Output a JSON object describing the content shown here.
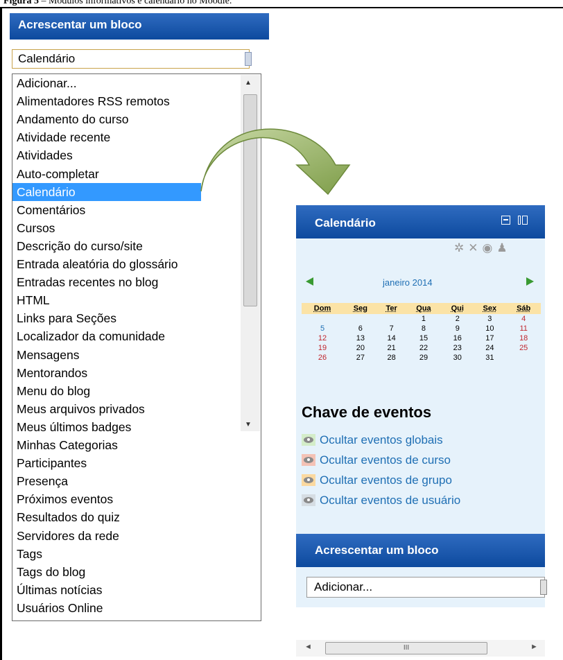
{
  "caption": {
    "label": "Figura 5",
    "text": " – Módulos informativos e calendário no Moodle."
  },
  "left_block": {
    "title": "Acrescentar um bloco",
    "select_value": "Calendário",
    "dropdown_items": [
      "Adicionar...",
      "Alimentadores RSS remotos",
      "Andamento do curso",
      "Atividade recente",
      "Atividades",
      "Auto-completar",
      "Calendário",
      "Comentários",
      "Cursos",
      "Descrição do curso/site",
      "Entrada aleatória do glossário",
      "Entradas recentes no blog",
      "HTML",
      "Links para Seções",
      "Localizador da comunidade",
      "Mensagens",
      "Mentorandos",
      "Menu do blog",
      "Meus arquivos privados",
      "Meus últimos badges",
      "Minhas Categorias",
      "Participantes",
      "Presença",
      "Próximos eventos",
      "Resultados do quiz",
      "Servidores da rede",
      "Tags",
      "Tags do blog",
      "Últimas notícias",
      "Usuários Online"
    ],
    "selected_item": "Calendário"
  },
  "calendar_block": {
    "title": "Calendário",
    "month": "janeiro 2014",
    "weekdays": [
      "Dom",
      "Seg",
      "Ter",
      "Qua",
      "Qui",
      "Sex",
      "Sáb"
    ],
    "weeks": [
      [
        "",
        "",
        "",
        "1",
        "2",
        "3",
        "4"
      ],
      [
        "5",
        "6",
        "7",
        "8",
        "9",
        "10",
        "11"
      ],
      [
        "12",
        "13",
        "14",
        "15",
        "16",
        "17",
        "18"
      ],
      [
        "19",
        "20",
        "21",
        "22",
        "23",
        "24",
        "25"
      ],
      [
        "26",
        "27",
        "28",
        "29",
        "30",
        "31",
        ""
      ]
    ],
    "key_title": "Chave de eventos",
    "key_items": [
      {
        "label": "Ocultar eventos globais",
        "color": "#d4edc9"
      },
      {
        "label": "Ocultar eventos de curso",
        "color": "#f4c2b5"
      },
      {
        "label": "Ocultar eventos de grupo",
        "color": "#fbd9a0"
      },
      {
        "label": "Ocultar eventos de usuário",
        "color": "#d6dde3"
      }
    ]
  },
  "add_block": {
    "title": "Acrescentar um bloco",
    "select_value": "Adicionar..."
  },
  "scrollbar": {
    "thumb_label": "III"
  },
  "colors": {
    "header_blue": "#0d4a9e",
    "selection_blue": "#3399ff",
    "panel_bg": "#e6f2fb",
    "link_blue": "#1f6fb4",
    "arrow_green": "#9db86a"
  }
}
